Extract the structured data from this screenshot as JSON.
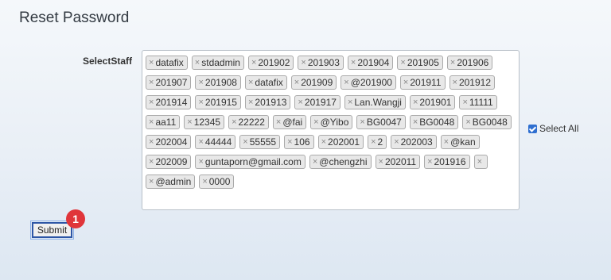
{
  "page": {
    "title": "Reset Password"
  },
  "form": {
    "select_staff_label": "SelectStaff",
    "selected_staff": [
      "datafix",
      "stdadmin",
      "201902",
      "201903",
      "201904",
      "201905",
      "201906",
      "201907",
      "201908",
      "datafix",
      "201909",
      "@201900",
      "201911",
      "201912",
      "201914",
      "201915",
      "201913",
      "201917",
      "Lan.Wangji",
      "201901",
      "11111",
      "aa11",
      "12345",
      "22222",
      "@fai",
      "@Yibo",
      "BG0047",
      "BG0048",
      "BG0048",
      "202004",
      "44444",
      "55555",
      "106",
      "202001",
      "2",
      "202003",
      "@kan",
      "202009",
      "guntaporn@gmail.com",
      "@chengzhi",
      "202011",
      "201916",
      "",
      "@admin",
      "0000"
    ],
    "tag_remove_glyph": "×",
    "select_all_label": "Select All",
    "select_all_checked": true,
    "submit_label": "Submit"
  },
  "annotation": {
    "step_number": "1",
    "badge_color": "#e0353a"
  }
}
